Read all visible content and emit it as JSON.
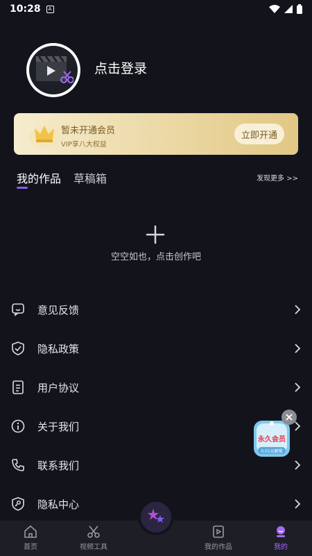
{
  "status_bar": {
    "time": "10:28",
    "notif_glyph": "A"
  },
  "profile": {
    "login_text": "点击登录"
  },
  "vip": {
    "title": "暂未开通会员",
    "subtitle": "VIP享八大权益",
    "button": "立即开通"
  },
  "tabs": [
    {
      "label": "我的作品",
      "active": true
    },
    {
      "label": "草稿箱",
      "active": false
    }
  ],
  "discover_more": "发现更多 >>",
  "empty": {
    "text": "空空如也，点击创作吧"
  },
  "menu": [
    {
      "label": "意见反馈",
      "icon": "feedback-icon"
    },
    {
      "label": "隐私政策",
      "icon": "shield-icon"
    },
    {
      "label": "用户协议",
      "icon": "document-icon"
    },
    {
      "label": "关于我们",
      "icon": "info-icon"
    },
    {
      "label": "联系我们",
      "icon": "phone-icon"
    },
    {
      "label": "隐私中心",
      "icon": "privacy-shield-icon"
    }
  ],
  "promo": {
    "title": "永久会员",
    "sub": "0.01元解锁"
  },
  "bottom_nav": [
    {
      "label": "首页",
      "icon": "home-icon",
      "active": false
    },
    {
      "label": "视频工具",
      "icon": "scissors-icon",
      "active": false
    },
    {
      "label": "我的作品",
      "icon": "video-folder-icon",
      "active": false
    },
    {
      "label": "我的",
      "icon": "user-icon",
      "active": true
    }
  ],
  "colors": {
    "accent": "#8a5cf6",
    "background": "#13141b",
    "vip_gold": "#e2c785"
  }
}
